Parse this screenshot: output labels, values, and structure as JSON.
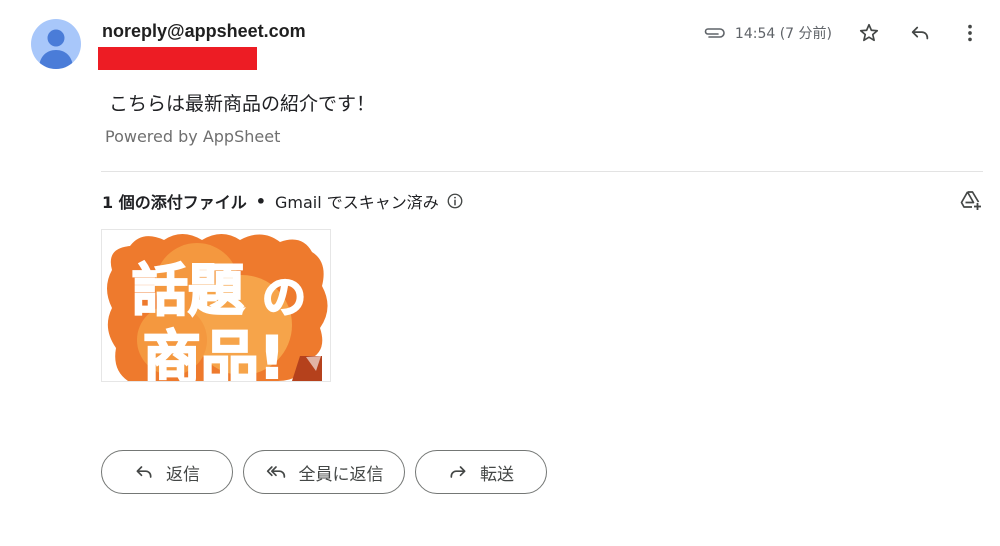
{
  "email": {
    "sender": "noreply@appsheet.com",
    "time": "14:54 (7 分前)",
    "body": "こちらは最新商品の紹介です！",
    "powered_by": "Powered by AppSheet"
  },
  "attachments": {
    "count_label": "1 個の添付ファイル",
    "separator": "•",
    "scan_label": "Gmail でスキャン済み",
    "thumbnail_text": "話題の商品！"
  },
  "actions": {
    "reply": "返信",
    "reply_all": "全員に返信",
    "forward": "転送"
  },
  "colors": {
    "redaction": "#ed1c24",
    "avatar_bg": "#a8c7fa",
    "avatar_fg": "#4a7cd8",
    "thumb_orange": "#ee7a2d"
  },
  "icons": [
    "person-avatar-icon",
    "paperclip-icon",
    "star-icon",
    "reply-icon",
    "more-vert-icon",
    "info-icon",
    "add-to-drive-icon",
    "forward-icon",
    "reply-all-icon"
  ]
}
